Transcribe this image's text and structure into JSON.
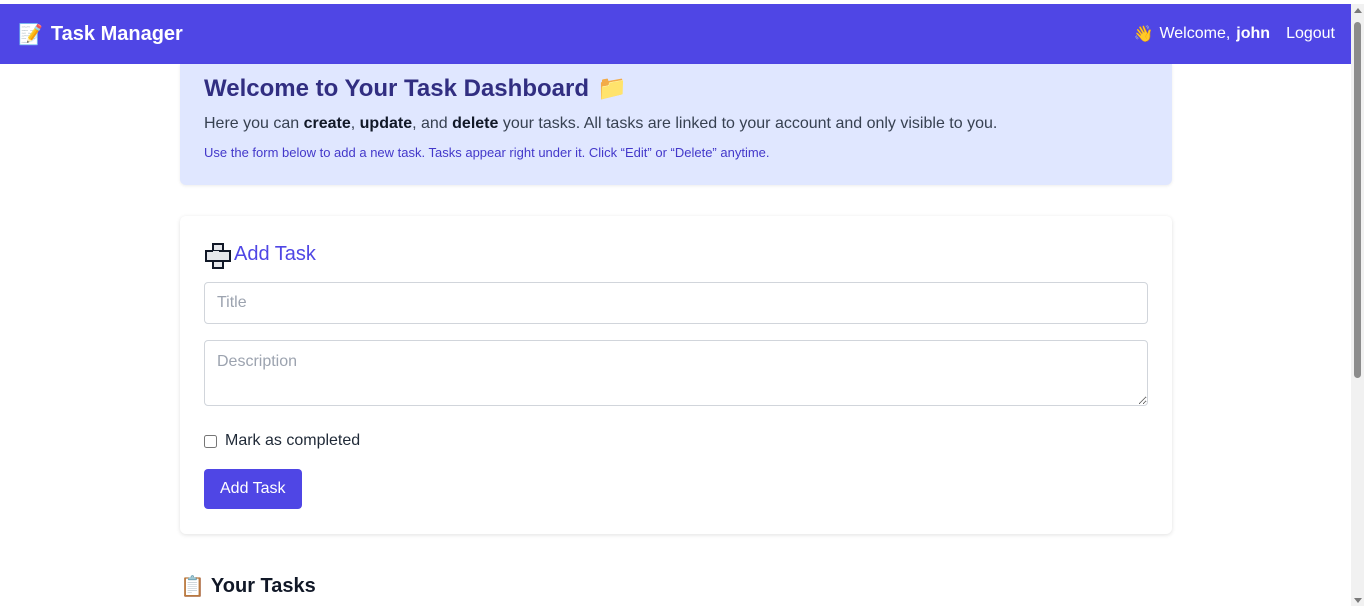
{
  "navbar": {
    "brand_icon": "📝",
    "brand": "Task Manager",
    "wave_icon": "👋",
    "welcome_prefix": "Welcome,",
    "username": "john",
    "logout_label": "Logout",
    "bg_color": "#4f46e5"
  },
  "hero": {
    "title": "Welcome to Your Task Dashboard",
    "title_icon": "📁",
    "lead_1": "Here you can ",
    "lead_create": "create",
    "lead_2": ", ",
    "lead_update": "update",
    "lead_3": ", and ",
    "lead_delete": "delete",
    "lead_4": " your tasks. All tasks are linked to your account and only visible to you.",
    "hint": "Use the form below to add a new task. Tasks appear right under it. Click “Edit” or “Delete” anytime.",
    "bg_color": "#e0e7ff"
  },
  "add_task": {
    "heading": "Add Task",
    "title_placeholder": "Title",
    "description_placeholder": "Description",
    "completed_label": "Mark as completed",
    "completed_checked": false,
    "submit_label": "Add Task"
  },
  "tasks": {
    "heading_icon": "📋",
    "heading": "Your Tasks"
  },
  "colors": {
    "accent": "#4f46e5",
    "hero_title": "#312e81",
    "hint": "#4338ca"
  }
}
